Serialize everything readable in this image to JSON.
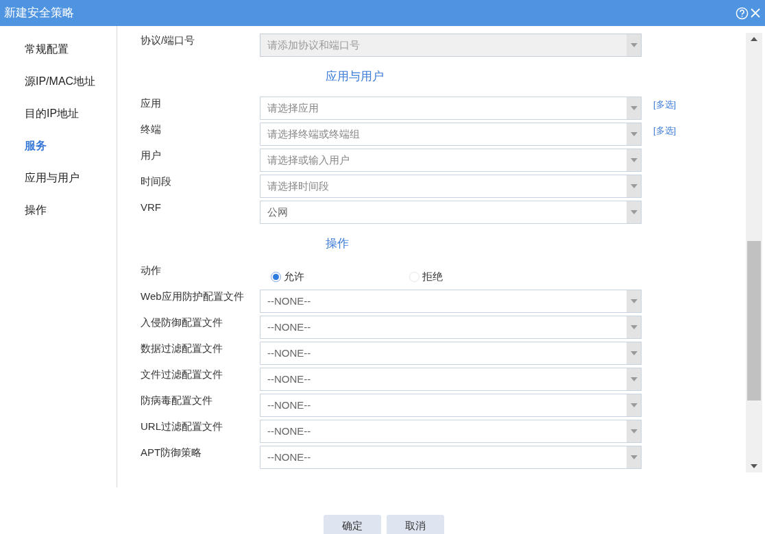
{
  "window": {
    "title": "新建安全策略"
  },
  "sidebar": {
    "items": [
      {
        "label": "常规配置",
        "selected": false
      },
      {
        "label": "源IP/MAC地址",
        "selected": false
      },
      {
        "label": "目的IP地址",
        "selected": false
      },
      {
        "label": "服务",
        "selected": true
      },
      {
        "label": "应用与用户",
        "selected": false
      },
      {
        "label": "操作",
        "selected": false
      }
    ]
  },
  "sections": [
    {
      "fields": [
        {
          "kind": "select",
          "label": "协议/端口号",
          "placeholder": "请添加协议和端口号",
          "disabled": true
        }
      ]
    },
    {
      "heading": "应用与用户",
      "fields": [
        {
          "kind": "select",
          "label": "应用",
          "placeholder": "请选择应用",
          "disabled": false,
          "link": "[多选]"
        },
        {
          "kind": "select",
          "label": "终端",
          "placeholder": "请选择终端或终端组",
          "disabled": false,
          "link": "[多选]"
        },
        {
          "kind": "select",
          "label": "用户",
          "placeholder": "请选择或输入用户",
          "disabled": false
        },
        {
          "kind": "select",
          "label": "时间段",
          "placeholder": "请选择时间段",
          "disabled": false
        },
        {
          "kind": "select",
          "label": "VRF",
          "value": "公网",
          "disabled": false
        }
      ]
    },
    {
      "heading": "操作",
      "fields": [
        {
          "kind": "radio",
          "label": "动作",
          "options": [
            {
              "label": "允许",
              "selected": true
            },
            {
              "label": "拒绝",
              "selected": false
            }
          ]
        },
        {
          "kind": "select",
          "label": "Web应用防护配置文件",
          "value": "--NONE--",
          "disabled": false
        },
        {
          "kind": "select",
          "label": "入侵防御配置文件",
          "value": "--NONE--",
          "disabled": false
        },
        {
          "kind": "select",
          "label": "数据过滤配置文件",
          "value": "--NONE--",
          "disabled": false
        },
        {
          "kind": "select",
          "label": "文件过滤配置文件",
          "value": "--NONE--",
          "disabled": false
        },
        {
          "kind": "select",
          "label": "防病毒配置文件",
          "value": "--NONE--",
          "disabled": false
        },
        {
          "kind": "select",
          "label": "URL过滤配置文件",
          "value": "--NONE--",
          "disabled": false
        },
        {
          "kind": "select",
          "label": "APT防御策略",
          "value": "--NONE--",
          "disabled": false
        }
      ]
    }
  ],
  "buttons": [
    "确定",
    "取消"
  ]
}
